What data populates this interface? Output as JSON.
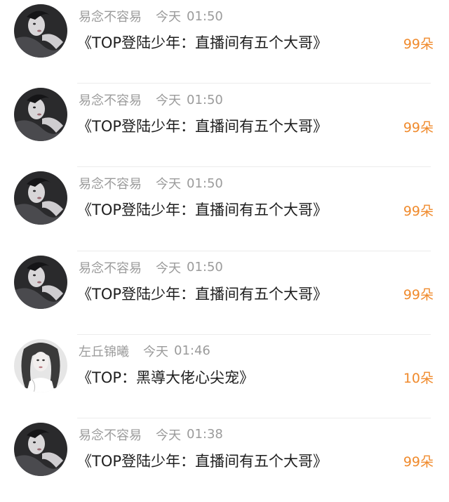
{
  "accent_color": "#f08a2c",
  "feed": [
    {
      "avatar_icon": "dark-portrait-avatar",
      "username": "易念不容易",
      "day": "今天",
      "time": "01:50",
      "title": "《TOP登陆少年：直播间有五个大哥》",
      "gift_count": "99朵"
    },
    {
      "avatar_icon": "dark-portrait-avatar",
      "username": "易念不容易",
      "day": "今天",
      "time": "01:50",
      "title": "《TOP登陆少年：直播间有五个大哥》",
      "gift_count": "99朵"
    },
    {
      "avatar_icon": "dark-portrait-avatar",
      "username": "易念不容易",
      "day": "今天",
      "time": "01:50",
      "title": "《TOP登陆少年：直播间有五个大哥》",
      "gift_count": "99朵"
    },
    {
      "avatar_icon": "dark-portrait-avatar",
      "username": "易念不容易",
      "day": "今天",
      "time": "01:50",
      "title": "《TOP登陆少年：直播间有五个大哥》",
      "gift_count": "99朵"
    },
    {
      "avatar_icon": "light-portrait-avatar",
      "username": "左丘锦曦",
      "day": "今天",
      "time": "01:46",
      "title": "《TOP：黑導大佬心尖宠》",
      "gift_count": "10朵"
    },
    {
      "avatar_icon": "dark-portrait-avatar",
      "username": "易念不容易",
      "day": "今天",
      "time": "01:38",
      "title": "《TOP登陆少年：直播间有五个大哥》",
      "gift_count": "99朵"
    }
  ]
}
